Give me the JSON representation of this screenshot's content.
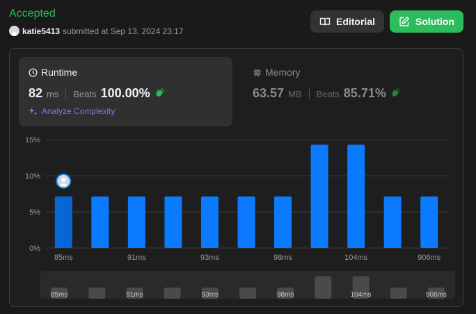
{
  "header": {
    "status": "Accepted",
    "username": "katie5413",
    "submitted_text": "submitted at Sep 13, 2024 23:17",
    "editorial_label": "Editorial",
    "solution_label": "Solution"
  },
  "runtime": {
    "title": "Runtime",
    "value": "82",
    "unit": "ms",
    "beats_label": "Beats",
    "beats_pct": "100.00%",
    "analyze_label": "Analyze Complexity"
  },
  "memory": {
    "title": "Memory",
    "value": "63.57",
    "unit": "MB",
    "beats_label": "Beats",
    "beats_pct": "85.71%"
  },
  "colors": {
    "accepted": "#2cbb5d",
    "bar": "#0a7aff",
    "bar_selected": "#0866d6",
    "analyze": "#8b6fe8"
  },
  "chart_data": {
    "type": "bar",
    "x_tick_labels": [
      "85ms",
      "91ms",
      "93ms",
      "98ms",
      "104ms",
      "906ms"
    ],
    "x_tick_bar_index": [
      0,
      2,
      4,
      6,
      8,
      10
    ],
    "y_ticks": [
      "0%",
      "5%",
      "10%",
      "15%"
    ],
    "ylim": [
      0,
      15
    ],
    "values": [
      7.14,
      7.14,
      7.14,
      7.14,
      7.14,
      7.14,
      7.14,
      14.29,
      14.29,
      7.14,
      7.14
    ],
    "selected_index": 0,
    "grid": true
  }
}
